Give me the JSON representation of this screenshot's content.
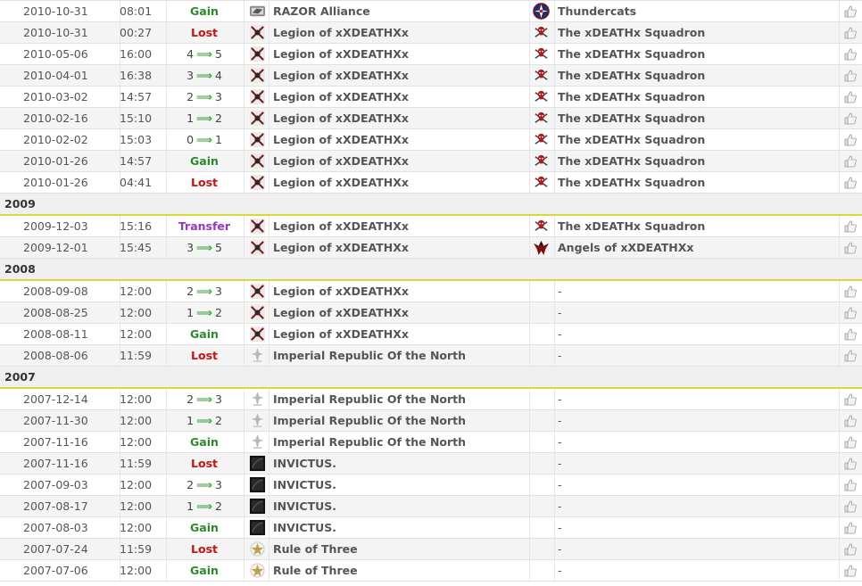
{
  "history": [
    {
      "kind": "row",
      "date": "2010-10-31",
      "time": "08:01",
      "change": {
        "type": "gain",
        "label": "Gain"
      },
      "holder": {
        "name": "RAZOR Alliance",
        "icon": "razor-logo-icon"
      },
      "previous": {
        "name": "Thundercats",
        "icon": "thundercats-logo-icon"
      }
    },
    {
      "kind": "row",
      "date": "2010-10-31",
      "time": "00:27",
      "change": {
        "type": "lost",
        "label": "Lost"
      },
      "holder": {
        "name": "Legion of xXDEATHXx",
        "icon": "legion-logo-icon"
      },
      "previous": {
        "name": "The xDEATHx Squadron",
        "icon": "skull-logo-icon"
      }
    },
    {
      "kind": "row",
      "date": "2010-05-06",
      "time": "16:00",
      "change": {
        "type": "level",
        "from": "4",
        "to": "5"
      },
      "holder": {
        "name": "Legion of xXDEATHXx",
        "icon": "legion-logo-icon"
      },
      "previous": {
        "name": "The xDEATHx Squadron",
        "icon": "skull-logo-icon"
      }
    },
    {
      "kind": "row",
      "date": "2010-04-01",
      "time": "16:38",
      "change": {
        "type": "level",
        "from": "3",
        "to": "4"
      },
      "holder": {
        "name": "Legion of xXDEATHXx",
        "icon": "legion-logo-icon"
      },
      "previous": {
        "name": "The xDEATHx Squadron",
        "icon": "skull-logo-icon"
      }
    },
    {
      "kind": "row",
      "date": "2010-03-02",
      "time": "14:57",
      "change": {
        "type": "level",
        "from": "2",
        "to": "3"
      },
      "holder": {
        "name": "Legion of xXDEATHXx",
        "icon": "legion-logo-icon"
      },
      "previous": {
        "name": "The xDEATHx Squadron",
        "icon": "skull-logo-icon"
      }
    },
    {
      "kind": "row",
      "date": "2010-02-16",
      "time": "15:10",
      "change": {
        "type": "level",
        "from": "1",
        "to": "2"
      },
      "holder": {
        "name": "Legion of xXDEATHXx",
        "icon": "legion-logo-icon"
      },
      "previous": {
        "name": "The xDEATHx Squadron",
        "icon": "skull-logo-icon"
      }
    },
    {
      "kind": "row",
      "date": "2010-02-02",
      "time": "15:03",
      "change": {
        "type": "level",
        "from": "0",
        "to": "1"
      },
      "holder": {
        "name": "Legion of xXDEATHXx",
        "icon": "legion-logo-icon"
      },
      "previous": {
        "name": "The xDEATHx Squadron",
        "icon": "skull-logo-icon"
      }
    },
    {
      "kind": "row",
      "date": "2010-01-26",
      "time": "14:57",
      "change": {
        "type": "gain",
        "label": "Gain"
      },
      "holder": {
        "name": "Legion of xXDEATHXx",
        "icon": "legion-logo-icon"
      },
      "previous": {
        "name": "The xDEATHx Squadron",
        "icon": "skull-logo-icon"
      }
    },
    {
      "kind": "row",
      "date": "2010-01-26",
      "time": "04:41",
      "change": {
        "type": "lost",
        "label": "Lost"
      },
      "holder": {
        "name": "Legion of xXDEATHXx",
        "icon": "legion-logo-icon"
      },
      "previous": {
        "name": "The xDEATHx Squadron",
        "icon": "skull-logo-icon"
      }
    },
    {
      "kind": "year",
      "label": "2009"
    },
    {
      "kind": "row",
      "date": "2009-12-03",
      "time": "15:16",
      "change": {
        "type": "transfer",
        "label": "Transfer"
      },
      "holder": {
        "name": "Legion of xXDEATHXx",
        "icon": "legion-logo-icon"
      },
      "previous": {
        "name": "The xDEATHx Squadron",
        "icon": "skull-logo-icon"
      }
    },
    {
      "kind": "row",
      "date": "2009-12-01",
      "time": "15:45",
      "change": {
        "type": "level",
        "from": "3",
        "to": "5"
      },
      "holder": {
        "name": "Legion of xXDEATHXx",
        "icon": "legion-logo-icon"
      },
      "previous": {
        "name": "Angels of xXDEATHXx",
        "icon": "angels-logo-icon"
      }
    },
    {
      "kind": "year",
      "label": "2008"
    },
    {
      "kind": "row",
      "date": "2008-09-08",
      "time": "12:00",
      "change": {
        "type": "level",
        "from": "2",
        "to": "3"
      },
      "holder": {
        "name": "Legion of xXDEATHXx",
        "icon": "legion-logo-icon"
      },
      "previous": {
        "name": "-",
        "icon": ""
      }
    },
    {
      "kind": "row",
      "date": "2008-08-25",
      "time": "12:00",
      "change": {
        "type": "level",
        "from": "1",
        "to": "2"
      },
      "holder": {
        "name": "Legion of xXDEATHXx",
        "icon": "legion-logo-icon"
      },
      "previous": {
        "name": "-",
        "icon": ""
      }
    },
    {
      "kind": "row",
      "date": "2008-08-11",
      "time": "12:00",
      "change": {
        "type": "gain",
        "label": "Gain"
      },
      "holder": {
        "name": "Legion of xXDEATHXx",
        "icon": "legion-logo-icon"
      },
      "previous": {
        "name": "-",
        "icon": ""
      }
    },
    {
      "kind": "row",
      "date": "2008-08-06",
      "time": "11:59",
      "change": {
        "type": "lost",
        "label": "Lost"
      },
      "holder": {
        "name": "Imperial Republic Of the North",
        "icon": "imperial-republic-logo-icon"
      },
      "previous": {
        "name": "-",
        "icon": ""
      }
    },
    {
      "kind": "year",
      "label": "2007"
    },
    {
      "kind": "row",
      "date": "2007-12-14",
      "time": "12:00",
      "change": {
        "type": "level",
        "from": "2",
        "to": "3"
      },
      "holder": {
        "name": "Imperial Republic Of the North",
        "icon": "imperial-republic-logo-icon"
      },
      "previous": {
        "name": "-",
        "icon": ""
      }
    },
    {
      "kind": "row",
      "date": "2007-11-30",
      "time": "12:00",
      "change": {
        "type": "level",
        "from": "1",
        "to": "2"
      },
      "holder": {
        "name": "Imperial Republic Of the North",
        "icon": "imperial-republic-logo-icon"
      },
      "previous": {
        "name": "-",
        "icon": ""
      }
    },
    {
      "kind": "row",
      "date": "2007-11-16",
      "time": "12:00",
      "change": {
        "type": "gain",
        "label": "Gain"
      },
      "holder": {
        "name": "Imperial Republic Of the North",
        "icon": "imperial-republic-logo-icon"
      },
      "previous": {
        "name": "-",
        "icon": ""
      }
    },
    {
      "kind": "row",
      "date": "2007-11-16",
      "time": "11:59",
      "change": {
        "type": "lost",
        "label": "Lost"
      },
      "holder": {
        "name": "INVICTUS.",
        "icon": "invictus-logo-icon"
      },
      "previous": {
        "name": "-",
        "icon": ""
      }
    },
    {
      "kind": "row",
      "date": "2007-09-03",
      "time": "12:00",
      "change": {
        "type": "level",
        "from": "2",
        "to": "3"
      },
      "holder": {
        "name": "INVICTUS.",
        "icon": "invictus-logo-icon"
      },
      "previous": {
        "name": "-",
        "icon": ""
      }
    },
    {
      "kind": "row",
      "date": "2007-08-17",
      "time": "12:00",
      "change": {
        "type": "level",
        "from": "1",
        "to": "2"
      },
      "holder": {
        "name": "INVICTUS.",
        "icon": "invictus-logo-icon"
      },
      "previous": {
        "name": "-",
        "icon": ""
      }
    },
    {
      "kind": "row",
      "date": "2007-08-03",
      "time": "12:00",
      "change": {
        "type": "gain",
        "label": "Gain"
      },
      "holder": {
        "name": "INVICTUS.",
        "icon": "invictus-logo-icon"
      },
      "previous": {
        "name": "-",
        "icon": ""
      }
    },
    {
      "kind": "row",
      "date": "2007-07-24",
      "time": "11:59",
      "change": {
        "type": "lost",
        "label": "Lost"
      },
      "holder": {
        "name": "Rule of Three",
        "icon": "rule-of-three-logo-icon"
      },
      "previous": {
        "name": "-",
        "icon": ""
      }
    },
    {
      "kind": "row",
      "date": "2007-07-06",
      "time": "12:00",
      "change": {
        "type": "gain",
        "label": "Gain"
      },
      "holder": {
        "name": "Rule of Three",
        "icon": "rule-of-three-logo-icon"
      },
      "previous": {
        "name": "-",
        "icon": ""
      }
    }
  ],
  "ui": {
    "arrow_glyph": "⟹",
    "like_icon": "thumbs-up-icon",
    "colors": {
      "gain": "#2a8a2a",
      "lost": "#cc1111",
      "transfer": "#9933cc",
      "arrow": "#34a534",
      "year_underline": "#d8d83a"
    }
  }
}
